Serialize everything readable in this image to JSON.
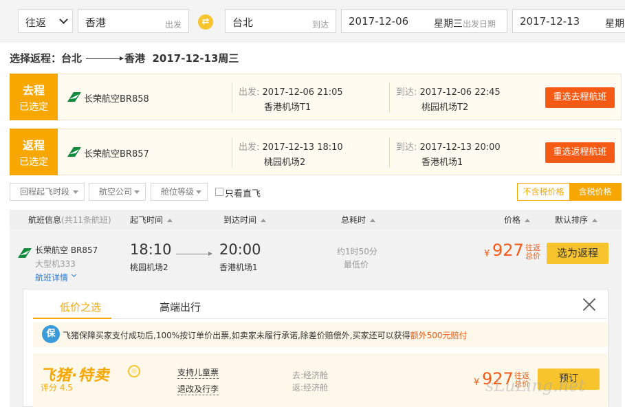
{
  "search": {
    "trip_type": "往返",
    "from_city": "香港",
    "from_suffix": "出发",
    "to_city": "台北",
    "to_suffix": "到达",
    "depart_date": "2017-12-06",
    "depart_dow": "星期三",
    "depart_suffix": "出发日期",
    "return_date": "2017-12-13",
    "return_dow": "星期"
  },
  "heading": {
    "prefix": "选择返程：台北",
    "to": "香港",
    "date": "2017-12-13周三"
  },
  "legs": [
    {
      "tag_top": "去程",
      "tag_bottom": "已选定",
      "airline": "长荣航空BR858",
      "dep_label": "出发:",
      "dep_time": "2017-12-06 21:05",
      "dep_airport": "香港机场T1",
      "arr_label": "到达:",
      "arr_time": "2017-12-06 22:45",
      "arr_airport": "桃园机场T2",
      "button": "重选去程航班"
    },
    {
      "tag_top": "返程",
      "tag_bottom": "已选定",
      "airline": "长荣航空BR857",
      "dep_label": "出发:",
      "dep_time": "2017-12-13 18:10",
      "dep_airport": "桃园机场2",
      "arr_label": "到达:",
      "arr_time": "2017-12-13 20:00",
      "arr_airport": "香港机场1",
      "button": "重选返程航班"
    }
  ],
  "filters": {
    "time": "回程起飞时段",
    "airline": "航空公司",
    "cabin": "舱位等级",
    "direct_only": "只看直飞",
    "tax_excluded": "不含税价格",
    "tax_included": "含税价格"
  },
  "columns": {
    "info": "航班信息",
    "count": "(共11条航班)",
    "dep": "起飞时间",
    "arr": "到达时间",
    "duration": "总耗时",
    "price": "价格",
    "sort": "默认排序"
  },
  "flight": {
    "airline": "长荣航空 BR857",
    "plane": "大型机333",
    "details": "航班详情",
    "dep_time": "18:10",
    "dep_airport": "桃园机场2",
    "arr_time": "20:00",
    "arr_airport": "香港机场1",
    "duration": "约1时50分",
    "lowest": "最低价",
    "currency": "¥",
    "price": "927",
    "price_tag_1": "往返",
    "price_tag_2": "总价",
    "select": "选为返程"
  },
  "panel": {
    "tab_low": "低价之选",
    "tab_high": "高端出行",
    "shield": "保",
    "notice_main": "飞猪保障买家支付成功后,100%按订单价出票,如卖家未履行承诺,除差价赔偿外,买家还可以获得",
    "notice_highlight": "额外500元赔付",
    "brand": "飞猪·特卖",
    "rating": "评分 4.5",
    "feature_1": "支持儿童票",
    "feature_2": "退改及行李",
    "cabin_out": "去:经济舱",
    "cabin_back": "返:经济舱",
    "currency": "¥",
    "price": "927",
    "price_tag_1": "往返",
    "price_tag_2": "总价",
    "book": "预订"
  },
  "watermark": "sLuLing.net",
  "colors": {
    "accent": "#f7a700",
    "button_orange": "#f55a14",
    "button_yellow": "#f7c42d",
    "link": "#2a7cd6"
  }
}
